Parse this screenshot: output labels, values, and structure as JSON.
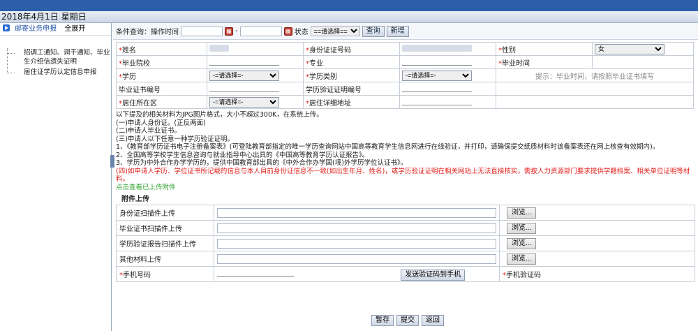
{
  "date_bar": "2018年4月1日 星期日",
  "sidebar": {
    "group": "邮寄业务申报",
    "expand": "全展开",
    "items": [
      "招调工通知、调干通知、毕业生介绍信遗失证明",
      "居住证学历认定信息申报"
    ]
  },
  "query": {
    "label": "条件查询：操作时间",
    "dash": "-",
    "status_label": "状态",
    "status_value": "==请选择==",
    "search": "查询",
    "add": "新增"
  },
  "form": {
    "name": "姓名",
    "id_no": "身份证证号码",
    "gender": "性别",
    "gender_value": "女",
    "school": "毕业院校",
    "major": "专业",
    "grad_time": "毕业时间",
    "edu": "学历",
    "select_placeholder": "-=请选择=-",
    "edu_type": "学历类别",
    "hint": "提示：毕业时间，请按照毕业证书填写",
    "cert_no": "毕业证书编号",
    "verify_no": "学历验证证明编号",
    "district": "居住所在区",
    "address": "居住详细地址"
  },
  "notes": {
    "intro": "以下提及的相关材料为JPG图片格式，大小不超过300K，在系统上传。",
    "l1": "(一)申请人身份证。(正反两面)",
    "l2": "(二)申请人毕业证书。",
    "l3": "(三)申请人以下任意一种学历验证证明。",
    "l4": "1、《教育部学历证书电子注册备案表》(可登陆教育部指定的唯一学历查询网站中国高等教育学生信息网进行在线验证，并打印，请确保提交纸质材料时该备案表还在网上核查有效期内)。",
    "l5": "2、全国高等学校学生信息咨询与就业指导中心出具的《中国高等教育学历认证报告》。",
    "l6": "3、学历为中外合作办学学历的，提供中国教育部出具的《中外合作办学国(境)外学历学位认证书》。",
    "red": "(四)如申请人学历、学位证书所记载的信息与本人目前身份证信息不一致(如出生年月、姓名)，或学历验证证明在相关网站上无法直接核实，需按人力资源部门要求提供学籍档案、相关单位证明等材料。",
    "green": "点击查看已上传附件"
  },
  "attach": {
    "title": "附件上传",
    "rows": [
      "身份证扫描件上传",
      "毕业证书扫描件上传",
      "学历验证报告扫描件上传",
      "其他材料上传"
    ],
    "browse": "浏览...",
    "phone": "手机号码",
    "send": "发送验证码到手机",
    "sms": "手机验证码"
  },
  "actions": {
    "save": "暂存",
    "submit": "提交",
    "back": "返回"
  }
}
